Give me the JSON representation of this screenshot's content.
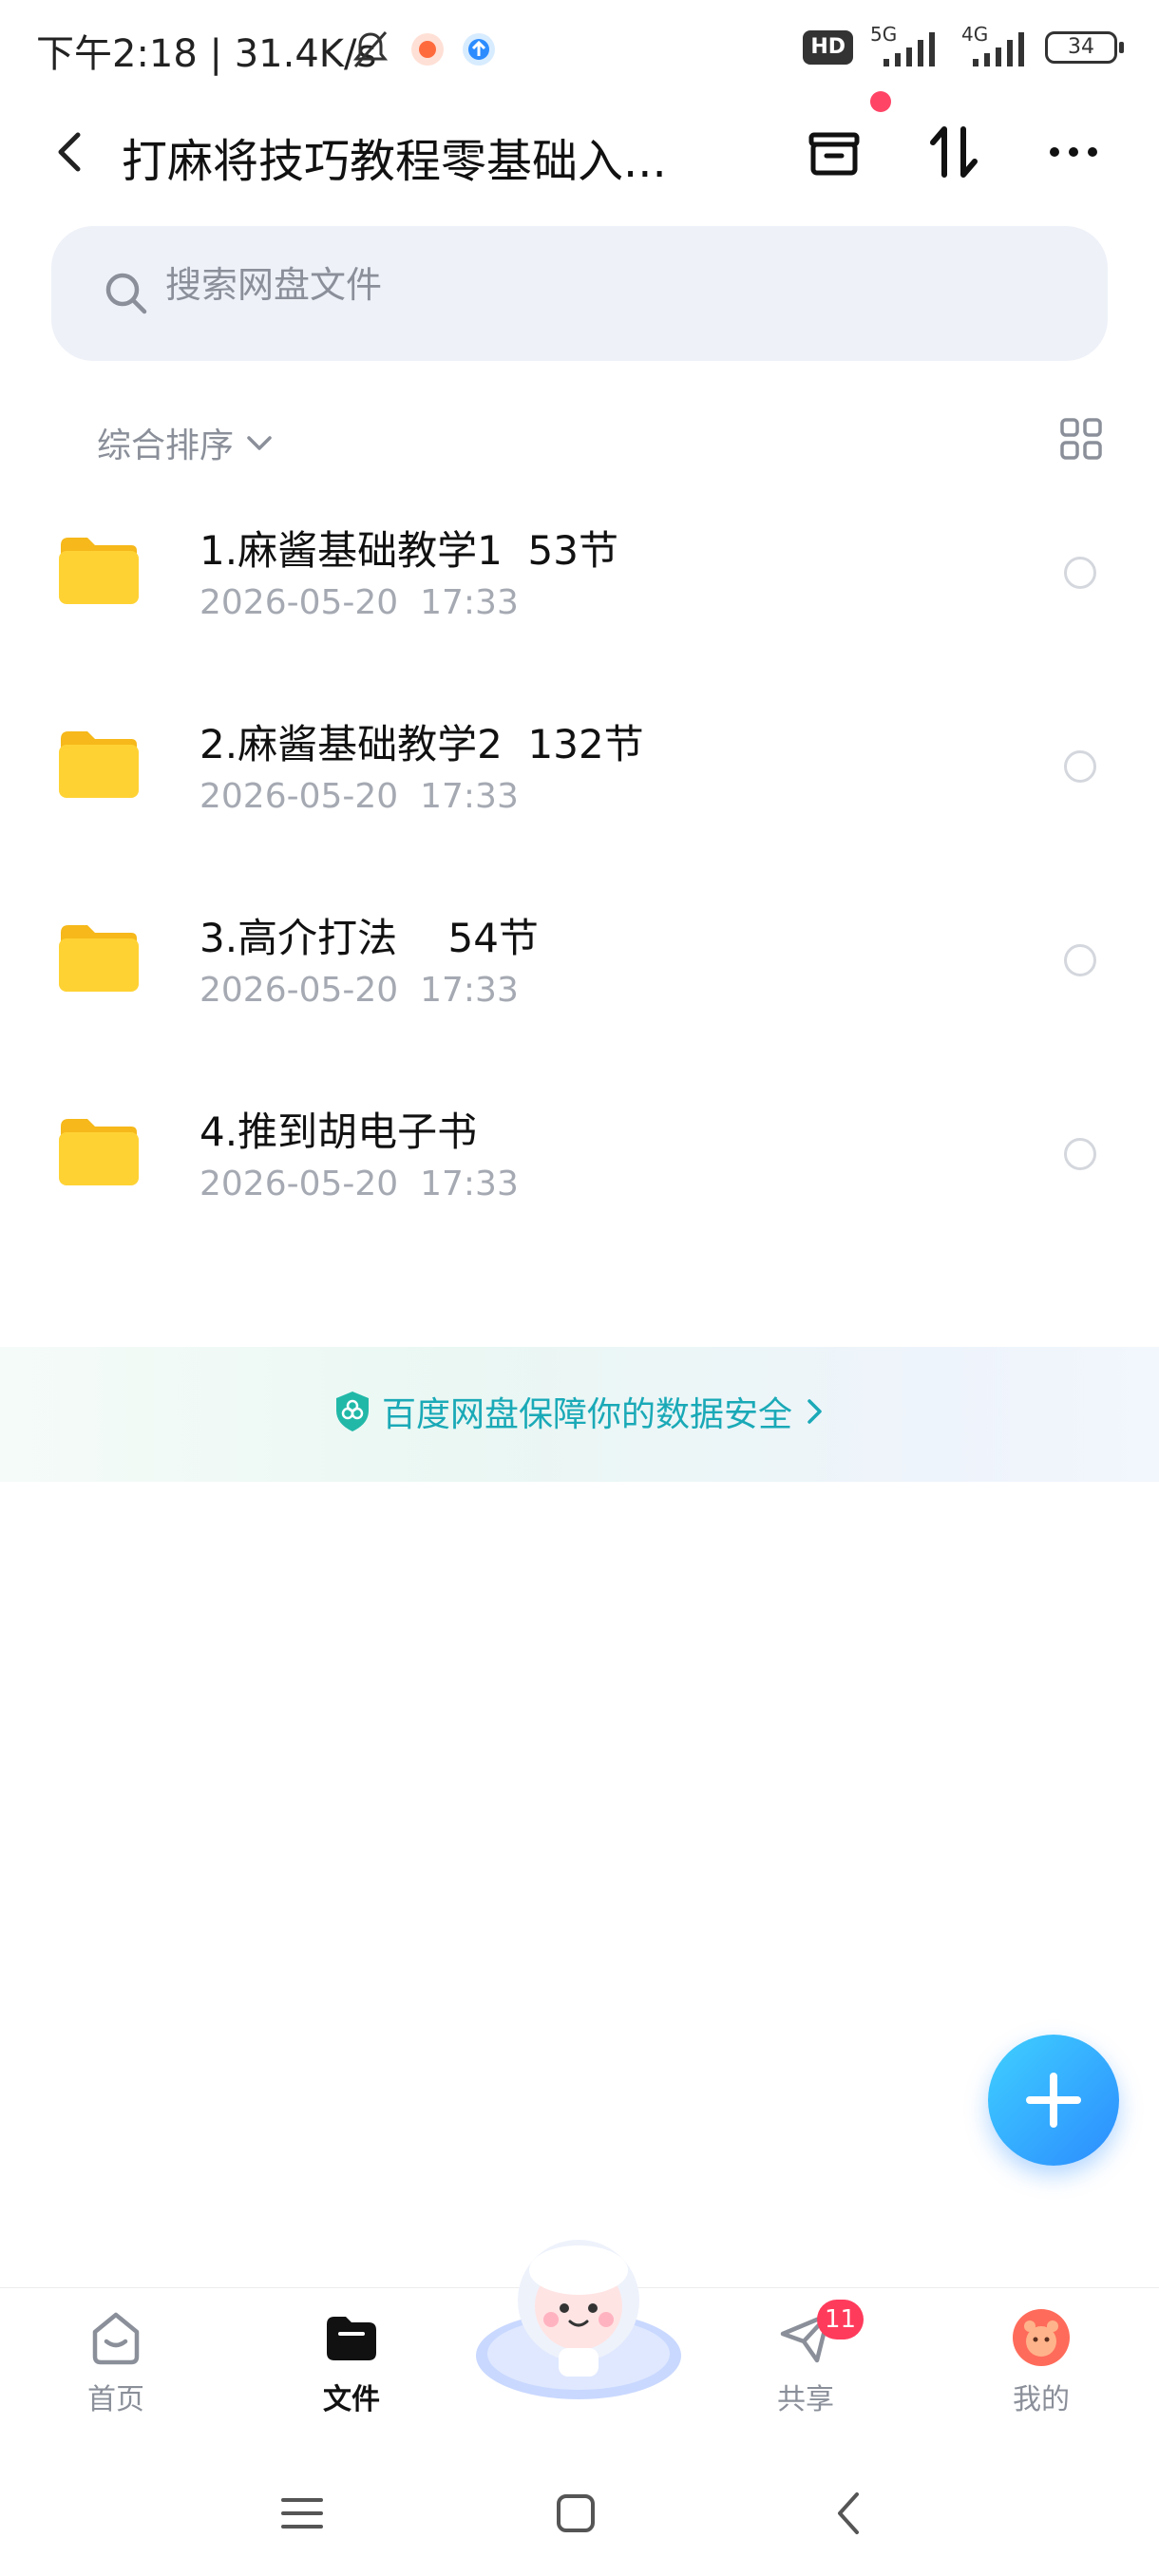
{
  "status_bar": {
    "time_speed": "下午2:18 | 31.4K/s",
    "hd_label": "HD",
    "net_5g": "5G",
    "net_4g": "4G",
    "battery": "34"
  },
  "header": {
    "title": "打麻将技巧教程零基础入...",
    "icons": [
      "back-icon",
      "archive-icon",
      "sort-transfer-icon",
      "more-icon"
    ]
  },
  "search": {
    "placeholder": "搜索网盘文件"
  },
  "sort": {
    "label": "综合排序"
  },
  "files": [
    {
      "name": "1.麻酱基础教学1  53节",
      "date": "2026-05-20  17:33"
    },
    {
      "name": "2.麻酱基础教学2  132节",
      "date": "2026-05-20  17:33"
    },
    {
      "name": "3.高介打法    54节",
      "date": "2026-05-20  17:33"
    },
    {
      "name": "4.推到胡电子书",
      "date": "2026-05-20  17:33"
    }
  ],
  "banner": {
    "text": "百度网盘保障你的数据安全"
  },
  "bottom_nav": {
    "home": "首页",
    "files": "文件",
    "share": "共享",
    "share_badge": "11",
    "mine": "我的"
  },
  "colors": {
    "accent": "#2c8cff",
    "banner_text": "#1aa9b7",
    "badge": "#ff3b5c",
    "folder": "#ffc928"
  }
}
